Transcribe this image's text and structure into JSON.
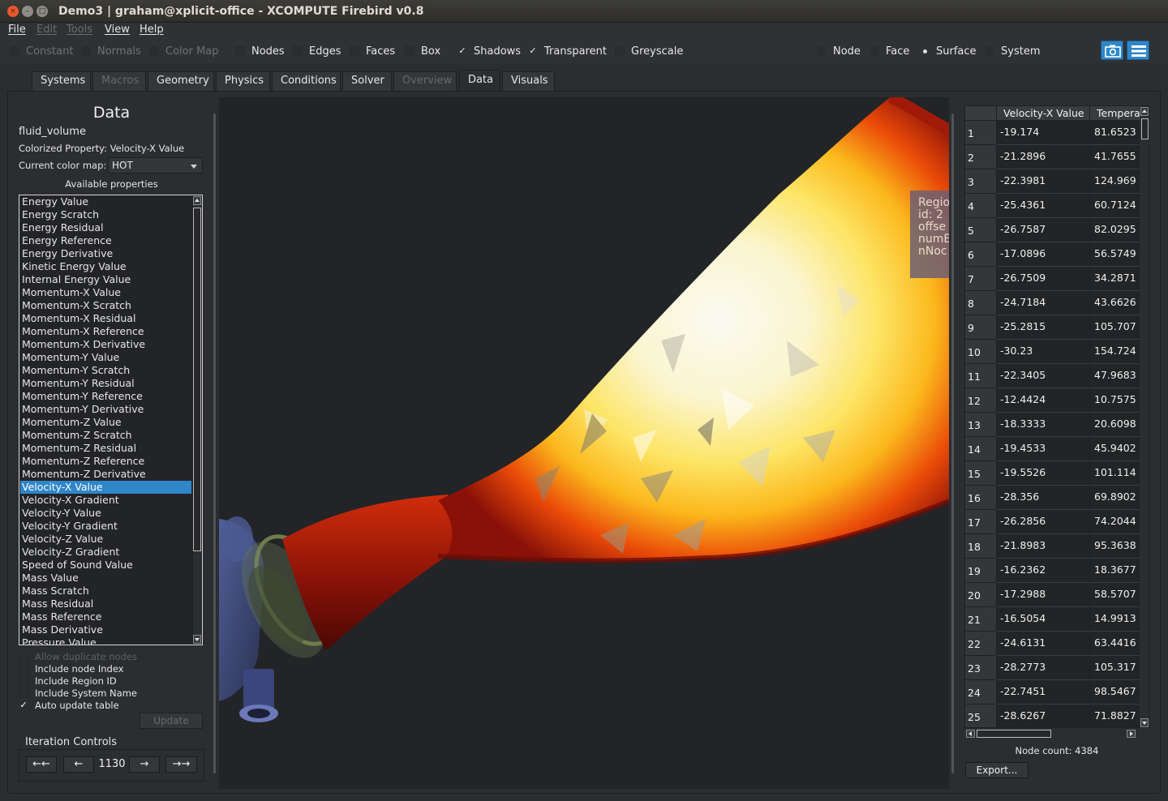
{
  "window": {
    "title": "Demo3 | graham@xplicit-office - XCOMPUTE Firebird v0.8",
    "close_glyph": "×",
    "min_glyph": "–",
    "max_glyph": "□"
  },
  "menubar": {
    "items": [
      {
        "label": "File",
        "enabled": true
      },
      {
        "label": "Edit",
        "enabled": false
      },
      {
        "label": "Tools",
        "enabled": false
      },
      {
        "label": "View",
        "enabled": true
      },
      {
        "label": "Help",
        "enabled": true
      }
    ]
  },
  "toolbar": {
    "shading": [
      {
        "label": "Constant",
        "enabled": false
      },
      {
        "label": "Normals",
        "enabled": false
      },
      {
        "label": "Color Map",
        "enabled": false
      }
    ],
    "display": [
      {
        "label": "Nodes",
        "checked": false
      },
      {
        "label": "Edges",
        "checked": false
      },
      {
        "label": "Faces",
        "checked": false
      },
      {
        "label": "Box",
        "checked": false
      },
      {
        "label": "Shadows",
        "checked": true
      },
      {
        "label": "Transparent",
        "checked": true
      },
      {
        "label": "Greyscale",
        "checked": false
      }
    ],
    "selection_mode": [
      {
        "label": "Node",
        "selected": false
      },
      {
        "label": "Face",
        "selected": false
      },
      {
        "label": "Surface",
        "selected": true
      },
      {
        "label": "System",
        "selected": false
      }
    ],
    "check_glyph": "✓",
    "camera_icon": "camera-icon",
    "menu_icon": "hamburger-menu-icon"
  },
  "tabs": [
    {
      "label": "Systems",
      "enabled": true,
      "active": false
    },
    {
      "label": "Macros",
      "enabled": false,
      "active": false
    },
    {
      "label": "Geometry",
      "enabled": true,
      "active": false
    },
    {
      "label": "Physics",
      "enabled": true,
      "active": false
    },
    {
      "label": "Conditions",
      "enabled": true,
      "active": false
    },
    {
      "label": "Solver",
      "enabled": true,
      "active": false
    },
    {
      "label": "Overview",
      "enabled": false,
      "active": false
    },
    {
      "label": "Data",
      "enabled": true,
      "active": true
    },
    {
      "label": "Visuals",
      "enabled": true,
      "active": false
    }
  ],
  "data_panel": {
    "title": "Data",
    "system_name": "fluid_volume",
    "colorized_property": "Colorized Property: Velocity-X Value",
    "color_map_label": "Current color map:",
    "color_map_value": "HOT",
    "available_label": "Available properties",
    "properties": [
      "Energy Value",
      "Energy Scratch",
      "Energy Residual",
      "Energy Reference",
      "Energy Derivative",
      "Kinetic Energy Value",
      "Internal Energy Value",
      "Momentum-X Value",
      "Momentum-X Scratch",
      "Momentum-X Residual",
      "Momentum-X Reference",
      "Momentum-X Derivative",
      "Momentum-Y Value",
      "Momentum-Y Scratch",
      "Momentum-Y Residual",
      "Momentum-Y Reference",
      "Momentum-Y Derivative",
      "Momentum-Z Value",
      "Momentum-Z Scratch",
      "Momentum-Z Residual",
      "Momentum-Z Reference",
      "Momentum-Z Derivative",
      "Velocity-X Value",
      "Velocity-X Gradient",
      "Velocity-Y Value",
      "Velocity-Y Gradient",
      "Velocity-Z Value",
      "Velocity-Z Gradient",
      "Speed of Sound Value",
      "Mass Value",
      "Mass Scratch",
      "Mass Residual",
      "Mass Reference",
      "Mass Derivative",
      "Pressure Value"
    ],
    "selected_property": "Velocity-X Value",
    "options": [
      {
        "label": "Allow duplicate nodes",
        "checked": false,
        "enabled": false
      },
      {
        "label": "Include node Index",
        "checked": false,
        "enabled": true
      },
      {
        "label": "Include Region ID",
        "checked": false,
        "enabled": true
      },
      {
        "label": "Include System Name",
        "checked": false,
        "enabled": true
      },
      {
        "label": "Auto update table",
        "checked": true,
        "enabled": true
      }
    ],
    "update_label": "Update",
    "iteration": {
      "title": "Iteration Controls",
      "first_label": "←←",
      "prev_label": "←",
      "value": "1130",
      "next_label": "→",
      "last_label": "→→"
    }
  },
  "viewport": {
    "tooltip_lines": [
      "Regio",
      "id: 2",
      "offse",
      "numE",
      "nNoc"
    ]
  },
  "table": {
    "columns": [
      "Velocity-X Value",
      "Temperature"
    ],
    "rows": [
      [
        "1",
        "-19.174",
        "81.6523"
      ],
      [
        "2",
        "-21.2896",
        "41.7655"
      ],
      [
        "3",
        "-22.3981",
        "124.969"
      ],
      [
        "4",
        "-25.4361",
        "60.7124"
      ],
      [
        "5",
        "-26.7587",
        "82.0295"
      ],
      [
        "6",
        "-17.0896",
        "56.5749"
      ],
      [
        "7",
        "-26.7509",
        "34.2871"
      ],
      [
        "8",
        "-24.7184",
        "43.6626"
      ],
      [
        "9",
        "-25.2815",
        "105.707"
      ],
      [
        "10",
        "-30.23",
        "154.724"
      ],
      [
        "11",
        "-22.3405",
        "47.9683"
      ],
      [
        "12",
        "-12.4424",
        "10.7575"
      ],
      [
        "13",
        "-18.3333",
        "20.6098"
      ],
      [
        "14",
        "-19.4533",
        "45.9402"
      ],
      [
        "15",
        "-19.5526",
        "101.114"
      ],
      [
        "16",
        "-28.356",
        "69.8902"
      ],
      [
        "17",
        "-26.2856",
        "74.2044"
      ],
      [
        "18",
        "-21.8983",
        "95.3638"
      ],
      [
        "19",
        "-16.2362",
        "18.3677"
      ],
      [
        "20",
        "-17.2988",
        "58.5707"
      ],
      [
        "21",
        "-16.5054",
        "14.9913"
      ],
      [
        "22",
        "-24.6131",
        "63.4416"
      ],
      [
        "23",
        "-28.2773",
        "105.317"
      ],
      [
        "24",
        "-22.7451",
        "98.5467"
      ],
      [
        "25",
        "-28.6267",
        "71.8827"
      ]
    ],
    "node_count": "Node count: 4384",
    "export_label": "Export..."
  },
  "colors": {
    "accent": "#2f86c9",
    "background": "#2b2d30",
    "close_button": "#e8592f"
  }
}
